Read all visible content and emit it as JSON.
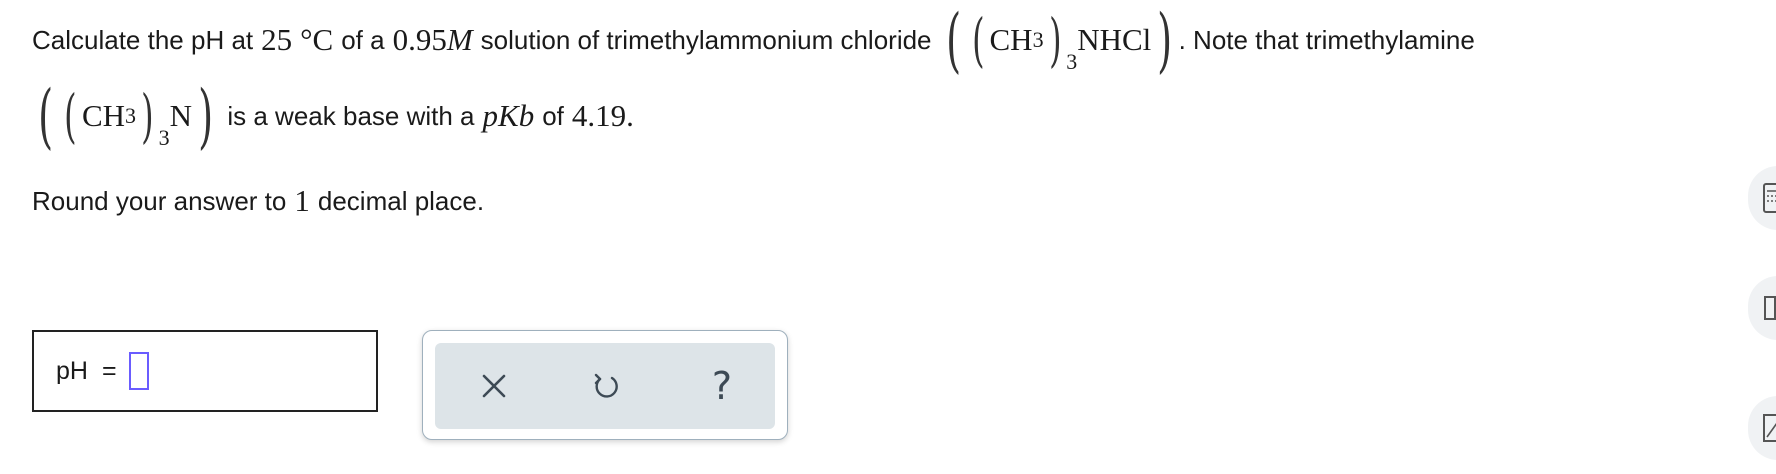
{
  "question": {
    "line1_prefix": "Calculate the pH at",
    "temperature": "25",
    "temp_unit": "°C",
    "of_a": "of a",
    "concentration": "0.95",
    "molar_symbol": "M",
    "line1_middle": "solution of trimethylammonium chloride",
    "salt_formula": {
      "ch": "CH",
      "sub_h": "3",
      "sub_group": "3",
      "rest": "NHCl"
    },
    "line1_suffix": ". Note that trimethylamine",
    "base_formula": {
      "ch": "CH",
      "sub_h": "3",
      "sub_group": "3",
      "rest": "N"
    },
    "line2_text": "is a weak base with a",
    "pk_p": "p",
    "pk_K": "K",
    "pk_sub": "b",
    "pk_of": "of",
    "pk_value": "4.19",
    "period": ".",
    "round_prefix": "Round your answer to",
    "round_digits": "1",
    "round_suffix": "decimal place."
  },
  "answer": {
    "label": "pH",
    "equals": "=",
    "value": ""
  },
  "toolbar": {
    "clear_icon": "close-icon",
    "undo_icon": "undo-icon",
    "help_symbol": "?"
  },
  "colors": {
    "input_border": "#6a5cff",
    "toolbar_bg": "#dde4e8",
    "toolbar_border": "#9fb0bd",
    "icon": "#3d4a55"
  }
}
